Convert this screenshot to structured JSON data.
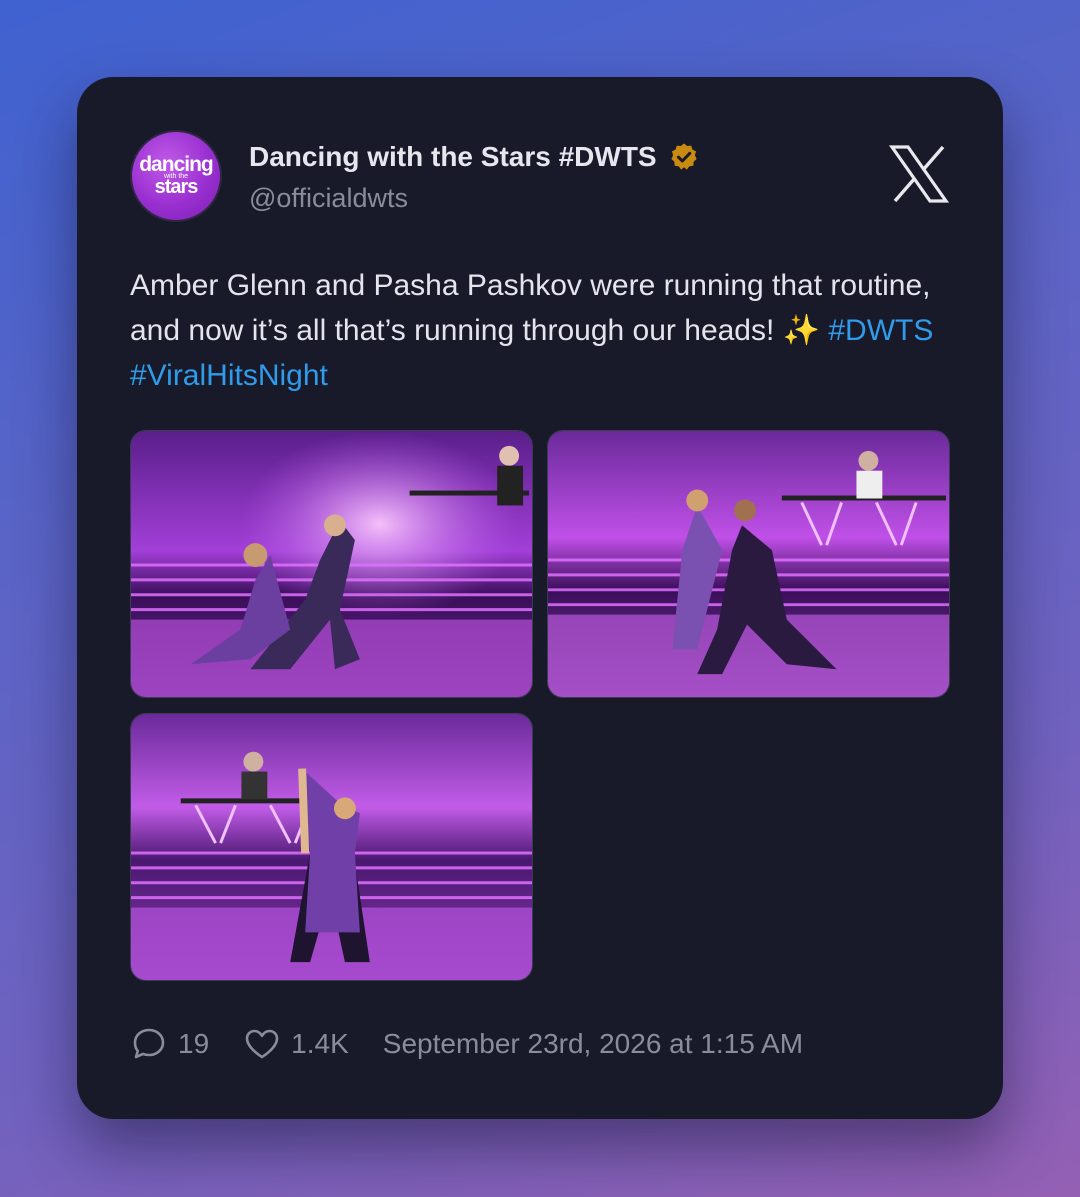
{
  "account": {
    "avatar_logo": {
      "line1": "dancing",
      "line2": "with the",
      "line3": "stars"
    },
    "display_name": "Dancing with the Stars #DWTS",
    "handle": "@officialdwts",
    "verified_badge_color": "#c98a12"
  },
  "platform_icon": "x-logo-icon",
  "post": {
    "text_part1": "Amber Glenn and Pasha Pashkov were running that routine, and now it’s all that’s running through our heads! ✨ ",
    "hashtag1": "#DWTS",
    "hashtag2": "#ViralHitsNight",
    "hashtag_color": "#2f9bea"
  },
  "media": {
    "images": [
      {
        "icon": "dance-photo-1"
      },
      {
        "icon": "dance-photo-2"
      },
      {
        "icon": "dance-photo-3"
      }
    ]
  },
  "footer": {
    "reply_count": "19",
    "like_count": "1.4K",
    "timestamp": "September 23rd, 2026 at 1:15 AM"
  }
}
